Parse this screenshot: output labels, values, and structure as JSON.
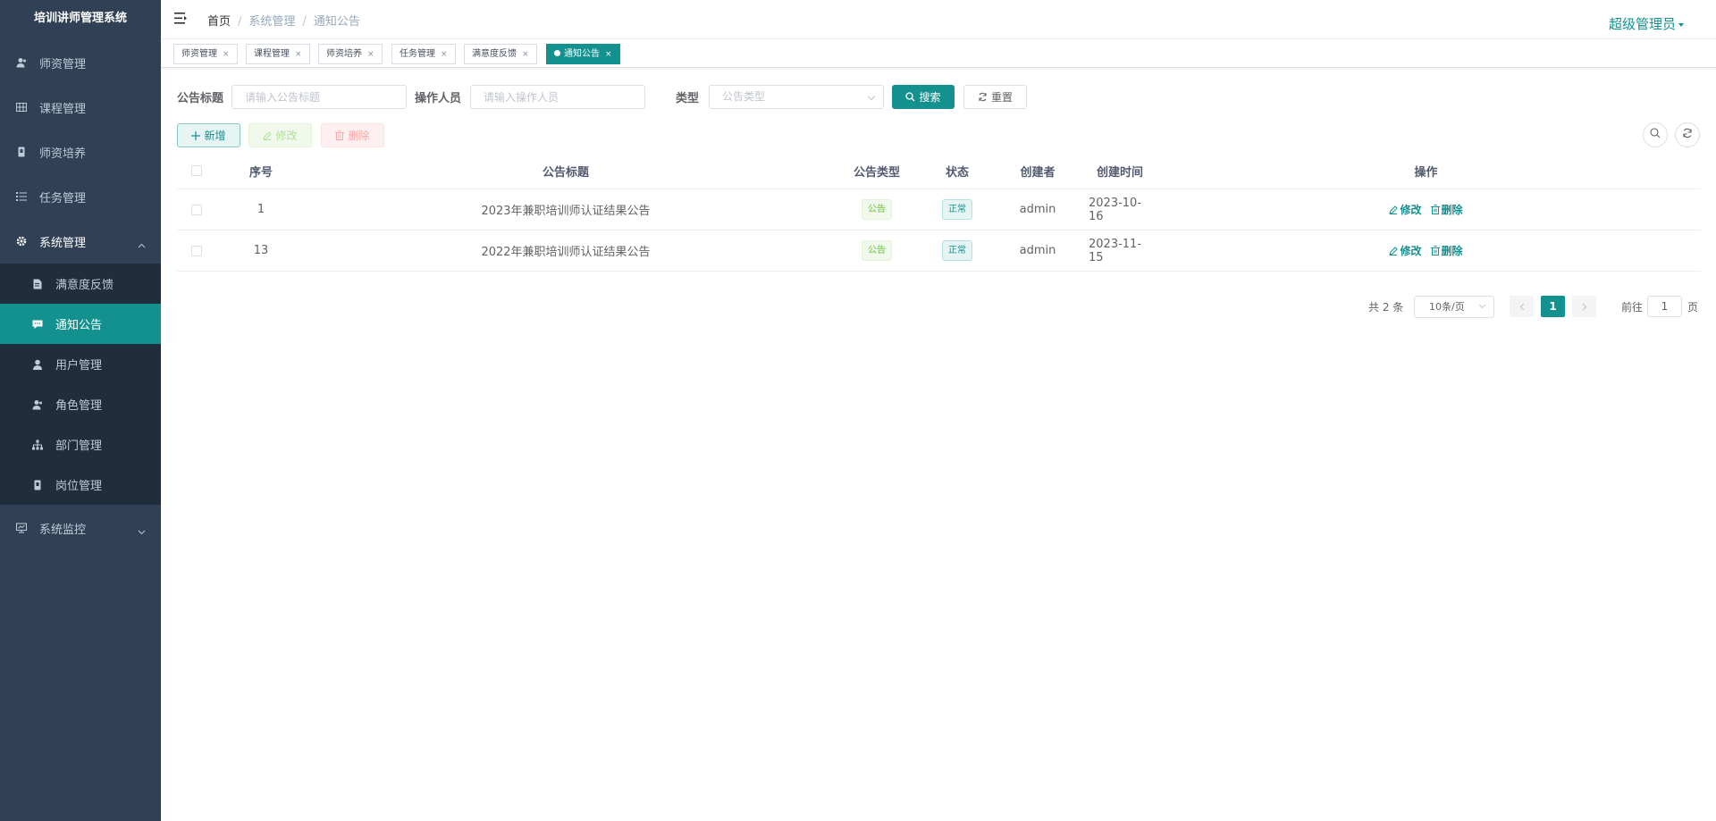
{
  "app_title": "培训讲师管理系统",
  "sidebar": {
    "items": [
      {
        "label": "师资管理",
        "icon": "user-icon"
      },
      {
        "label": "课程管理",
        "icon": "grid-icon"
      },
      {
        "label": "师资培养",
        "icon": "badge-icon"
      },
      {
        "label": "任务管理",
        "icon": "list-icon"
      },
      {
        "label": "系统管理",
        "icon": "gear-icon",
        "expanded": true,
        "children": [
          {
            "label": "满意度反馈",
            "icon": "document-icon"
          },
          {
            "label": "通知公告",
            "icon": "message-icon",
            "active": true
          },
          {
            "label": "用户管理",
            "icon": "user-icon"
          },
          {
            "label": "角色管理",
            "icon": "users-icon"
          },
          {
            "label": "部门管理",
            "icon": "tree-icon"
          },
          {
            "label": "岗位管理",
            "icon": "badge-icon"
          }
        ]
      },
      {
        "label": "系统监控",
        "icon": "monitor-icon"
      }
    ]
  },
  "header": {
    "breadcrumb": [
      "首页",
      "系统管理",
      "通知公告"
    ],
    "breadcrumb_sep": "/",
    "user_name": "超级管理员"
  },
  "tags": [
    {
      "label": "师资管理",
      "close": "×"
    },
    {
      "label": "课程管理",
      "close": "×"
    },
    {
      "label": "师资培养",
      "close": "×"
    },
    {
      "label": "任务管理",
      "close": "×"
    },
    {
      "label": "满意度反馈",
      "close": "×"
    },
    {
      "label": "通知公告",
      "close": "×",
      "active": true
    }
  ],
  "search": {
    "title_label": "公告标题",
    "title_placeholder": "请输入公告标题",
    "operator_label": "操作人员",
    "operator_placeholder": "请输入操作人员",
    "type_label": "类型",
    "type_placeholder": "公告类型",
    "search_btn": "搜索",
    "reset_btn": "重置"
  },
  "toolbar": {
    "add": "新增",
    "edit": "修改",
    "delete": "删除"
  },
  "table": {
    "columns": [
      "序号",
      "公告标题",
      "公告类型",
      "状态",
      "创建者",
      "创建时间",
      "操作"
    ],
    "rows": [
      {
        "id": "1",
        "title": "2023年兼职培训师认证结果公告",
        "type": "公告",
        "status": "正常",
        "creator": "admin",
        "created": "2023-10-16",
        "edit": "修改",
        "delete": "删除"
      },
      {
        "id": "13",
        "title": "2022年兼职培训师认证结果公告",
        "type": "公告",
        "status": "正常",
        "creator": "admin",
        "created": "2023-11-15",
        "edit": "修改",
        "delete": "删除"
      }
    ]
  },
  "pagination": {
    "total": "共 2 条",
    "page_size": "10条/页",
    "current_page": "1",
    "goto_prefix": "前往",
    "goto_value": "1",
    "goto_suffix": "页"
  },
  "colors": {
    "primary": "#13918f",
    "sidebar_bg": "#304156",
    "submenu_bg": "#1f2d3d"
  }
}
